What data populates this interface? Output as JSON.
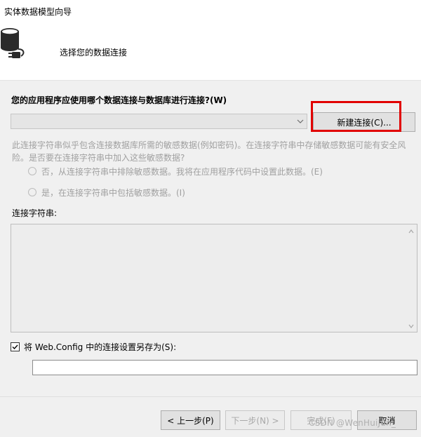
{
  "window": {
    "title": "实体数据模型向导"
  },
  "header": {
    "title": "选择您的数据连接",
    "icon": "database-plug-icon"
  },
  "body": {
    "question": "您的应用程序应使用哪个数据连接与数据库进行连接?(W)",
    "connection_select": {
      "value": "",
      "icon": "chevron-down-icon"
    },
    "new_connection_button": "新建连接(C)...",
    "sensitive_note": "此连接字符串似乎包含连接数据库所需的敏感数据(例如密码)。在连接字符串中存储敏感数据可能有安全风险。是否要在连接字符串中加入这些敏感数据?",
    "radio_no": "否，从连接字符串中排除敏感数据。我将在应用程序代码中设置此数据。(E)",
    "radio_yes": "是，在连接字符串中包括敏感数据。(I)",
    "connection_string_label": "连接字符串:",
    "connection_string_value": "",
    "save_checkbox": {
      "label": "将 Web.Config 中的连接设置另存为(S):",
      "checked": true
    },
    "save_name_value": ""
  },
  "footer": {
    "prev_label": "< 上一步(P)",
    "next_label": "下一步(N) >",
    "finish_label": "完成(F)",
    "cancel_label": "取消"
  },
  "watermark": "CSDN @WenHuiJun_",
  "colors": {
    "highlight_border": "#e10000",
    "body_background": "#f0f0f0",
    "disabled_text": "#a0a0a0"
  }
}
